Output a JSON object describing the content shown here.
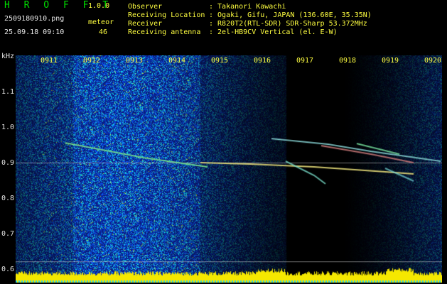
{
  "header": {
    "app_title": "H R O F F T",
    "version": "1.0.0",
    "file_name": "2509180910.png",
    "detect_label": "meteor",
    "timestamp": "25.09.18 09:10",
    "detect_count": "46"
  },
  "station": {
    "observer_label": "Observer",
    "observer_value": ": Takanori Kawachi",
    "location_label": "Receiving Location",
    "location_value": ": Ogaki, Gifu, JAPAN (136.60E, 35.35N)",
    "receiver_label": "Receiver",
    "receiver_value": ": R820T2(RTL-SDR) SDR-Sharp 53.372MHz",
    "antenna_label": "Receiving antenna",
    "antenna_value": ": 2el-HB9CV Vertical (el. E-W)"
  },
  "axes": {
    "y_unit": "kHz",
    "x_ticks": [
      "0911",
      "0912",
      "0913",
      "0914",
      "0915",
      "0916",
      "0917",
      "0918",
      "0919",
      "0920"
    ],
    "y_ticks": [
      "1.1",
      "1.0",
      "0.9",
      "0.8",
      "0.7",
      "0.6"
    ]
  },
  "colors": {
    "label": "#ffff40",
    "title": "#00e000",
    "background_noise": "#0b2a8a",
    "signal_bar": "#f5e800"
  }
}
